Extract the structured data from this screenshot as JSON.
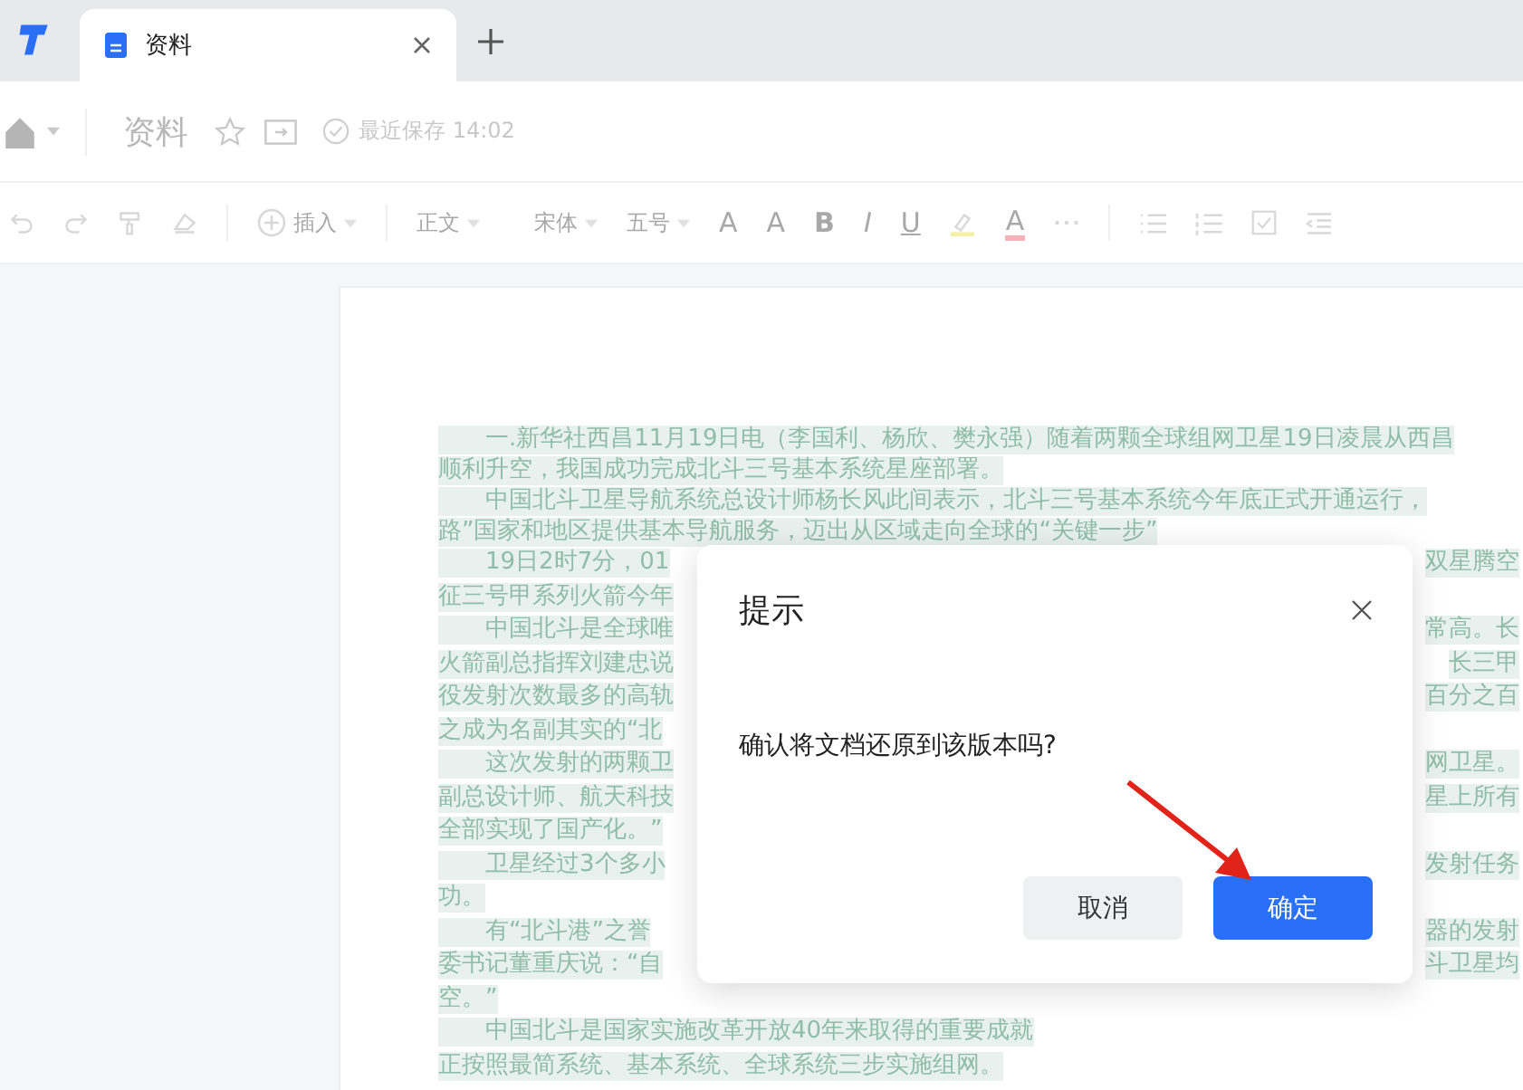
{
  "tabs": [
    {
      "label": "资料",
      "selected": true
    }
  ],
  "header": {
    "title": "资料",
    "save_status": "最近保存 14:02"
  },
  "toolbar": {
    "insert": "插入",
    "paragraph_style": "正文",
    "font": "宋体",
    "font_size": "五号",
    "grow": "A",
    "shrink": "A",
    "bold": "B",
    "italic": "I",
    "underline": "U",
    "font_color": "A"
  },
  "document": {
    "lines": [
      {
        "indent": true,
        "text": "一.新华社西昌11月19日电（李国利、杨欣、樊永强）随着两颗全球组网卫星19日凌晨从西昌"
      },
      {
        "indent": false,
        "text": "顺利升空，我国成功完成北斗三号基本系统星座部署。"
      },
      {
        "indent": true,
        "text": "中国北斗卫星导航系统总设计师杨长风此间表示，北斗三号基本系统今年底正式开通运行，"
      },
      {
        "indent": false,
        "text": "路”国家和地区提供基本导航服务，迈出从区域走向全球的“关键一步”"
      },
      {
        "indent": true,
        "text": "19日2时7分，01",
        "right": "双星腾空"
      },
      {
        "indent": false,
        "text": "征三号甲系列火箭今年"
      },
      {
        "indent": true,
        "text": "中国北斗是全球唯",
        "right": "常高。长"
      },
      {
        "indent": false,
        "text": "火箭副总指挥刘建忠说",
        "right": "长三甲"
      },
      {
        "indent": false,
        "text": "役发射次数最多的高轨",
        "right": "百分之百"
      },
      {
        "indent": false,
        "text": "之成为名副其实的“北"
      },
      {
        "indent": true,
        "text": "这次发射的两颗卫",
        "right": "网卫星。"
      },
      {
        "indent": false,
        "text": "副总设计师、航天科技",
        "right": "星上所有"
      },
      {
        "indent": false,
        "text": "全部实现了国产化。”"
      },
      {
        "indent": true,
        "text": "卫星经过3个多小",
        "right": "发射任务"
      },
      {
        "indent": false,
        "text": "功。"
      },
      {
        "indent": true,
        "text": "有“北斗港”之誉",
        "right": "器的发射"
      },
      {
        "indent": false,
        "text": "委书记董重庆说：“自",
        "right": "斗卫星均"
      },
      {
        "indent": false,
        "text": "空。”"
      },
      {
        "indent": true,
        "text": "中国北斗是国家实施改革开放40年来取得的重要成就"
      },
      {
        "indent": false,
        "text": "正按照最简系统、基本系统、全球系统三步实施组网。"
      }
    ]
  },
  "dialog": {
    "title": "提示",
    "message": "确认将文档还原到该版本吗?",
    "buttons": [
      {
        "label": "取消",
        "kind": "secondary"
      },
      {
        "label": "确定",
        "kind": "primary"
      }
    ]
  }
}
